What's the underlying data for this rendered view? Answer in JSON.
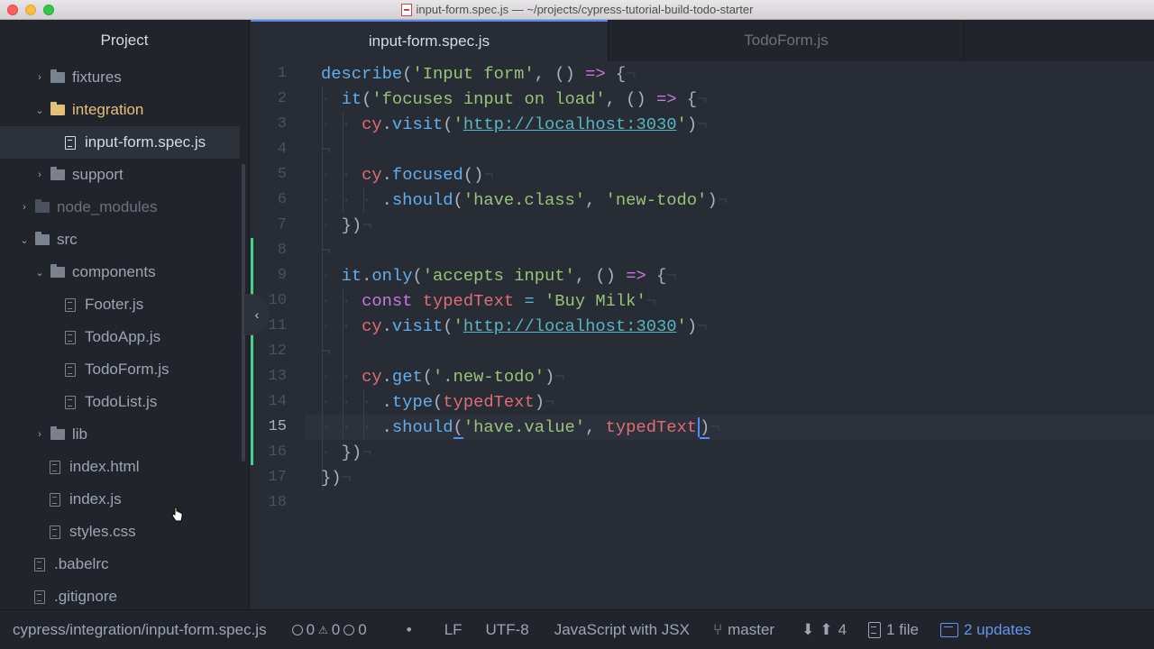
{
  "window": {
    "title": "input-form.spec.js — ~/projects/cypress-tutorial-build-todo-starter"
  },
  "sidebar": {
    "header": "Project",
    "items": [
      {
        "label": "fixtures",
        "kind": "folder",
        "expanded": false
      },
      {
        "label": "integration",
        "kind": "folder",
        "expanded": true
      },
      {
        "label": "input-form.spec.js",
        "kind": "file",
        "selected": true
      },
      {
        "label": "support",
        "kind": "folder",
        "expanded": false
      },
      {
        "label": "node_modules",
        "kind": "folder",
        "expanded": false
      },
      {
        "label": "src",
        "kind": "folder",
        "expanded": true
      },
      {
        "label": "components",
        "kind": "folder",
        "expanded": true
      },
      {
        "label": "Footer.js",
        "kind": "file"
      },
      {
        "label": "TodoApp.js",
        "kind": "file"
      },
      {
        "label": "TodoForm.js",
        "kind": "file"
      },
      {
        "label": "TodoList.js",
        "kind": "file"
      },
      {
        "label": "lib",
        "kind": "folder",
        "expanded": false
      },
      {
        "label": "index.html",
        "kind": "file"
      },
      {
        "label": "index.js",
        "kind": "file"
      },
      {
        "label": "styles.css",
        "kind": "file"
      },
      {
        "label": ".babelrc",
        "kind": "file"
      },
      {
        "label": ".gitignore",
        "kind": "file"
      }
    ]
  },
  "tabs": [
    {
      "label": "input-form.spec.js",
      "active": true
    },
    {
      "label": "TodoForm.js",
      "active": false
    }
  ],
  "editor": {
    "cursor_line": 15,
    "line_numbers": [
      "1",
      "2",
      "3",
      "4",
      "5",
      "6",
      "7",
      "8",
      "9",
      "10",
      "11",
      "12",
      "13",
      "14",
      "15",
      "16",
      "17",
      "18"
    ],
    "tokens": {
      "describe": "describe",
      "input_form": "'Input form'",
      "it": "it",
      "focuses": "'focuses input on load'",
      "cy": "cy",
      "visit": "visit",
      "url": "http://localhost:3030",
      "focused": "focused",
      "should": "should",
      "have_class": "'have.class'",
      "new_todo": "'new-todo'",
      "only": "only",
      "accepts": "'accepts input'",
      "const": "const",
      "typedText": "typedText",
      "buy_milk": "'Buy Milk'",
      "get": "get",
      "new_todo_sel": "'.new-todo'",
      "type": "type",
      "have_value": "'have.value'"
    }
  },
  "statusbar": {
    "path": "cypress/integration/input-form.spec.js",
    "errors": "0",
    "warnings": "0",
    "infos": "0",
    "dot": "•",
    "line_ending": "LF",
    "encoding": "UTF-8",
    "grammar": "JavaScript with JSX",
    "branch": "master",
    "ahead": "4",
    "files": "1 file",
    "updates": "2 updates"
  },
  "colors": {
    "accent": "#568af2",
    "git_added": "#43d08a",
    "folder_highlight": "#e5c07b",
    "updates": "#6494ed"
  }
}
